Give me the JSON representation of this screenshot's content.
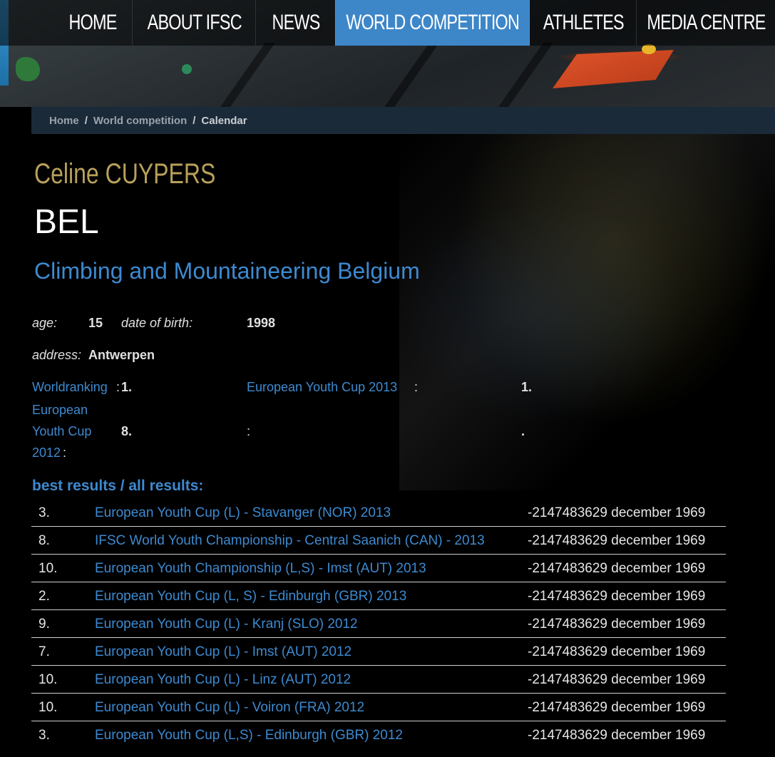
{
  "nav": {
    "items": [
      {
        "label": "HOME",
        "active": false
      },
      {
        "label": "ABOUT IFSC",
        "active": false
      },
      {
        "label": "NEWS",
        "active": false
      },
      {
        "label": "WORLD COMPETITION",
        "active": true
      },
      {
        "label": "ATHLETES",
        "active": false
      },
      {
        "label": "MEDIA CENTRE",
        "active": false
      }
    ]
  },
  "breadcrumb": {
    "home": "Home",
    "sep1": "/",
    "world_competition": "World competition",
    "sep2": "/",
    "current": "Calendar"
  },
  "athlete": {
    "name": "Celine CUYPERS",
    "country": "BEL",
    "federation": "Climbing and Mountaineering Belgium",
    "age_label": "age:",
    "age": "15",
    "dob_label": "date of birth:",
    "dob": "1998",
    "address_label": "address:",
    "address": "Antwerpen"
  },
  "rankings": {
    "worldranking_label": "Worldranking",
    "worldranking_colon": ":",
    "worldranking_value": "1.",
    "euc2013_label": "European Youth Cup 2013",
    "euc2013_colon": ":",
    "euc2013_value": "1.",
    "euc2012_line1": "European",
    "euc2012_line2": "Youth Cup",
    "euc2012_line3": "2012",
    "euc2012_colon": ":",
    "euc2012_value": "8.",
    "empty_colon": ":",
    "empty_value": "."
  },
  "results": {
    "heading": "best results / all results:",
    "rows": [
      {
        "rank": "3.",
        "event": "European Youth Cup (L) - Stavanger (NOR) 2013",
        "date": "-2147483629 december 1969"
      },
      {
        "rank": "8.",
        "event": "IFSC World Youth Championship - Central Saanich (CAN) - 2013",
        "date": "-2147483629 december 1969"
      },
      {
        "rank": "10.",
        "event": "European Youth Championship (L,S) - Imst (AUT) 2013",
        "date": "-2147483629 december 1969"
      },
      {
        "rank": "2.",
        "event": "European Youth Cup (L, S) - Edinburgh (GBR) 2013",
        "date": "-2147483629 december 1969"
      },
      {
        "rank": "9.",
        "event": "European Youth Cup (L) - Kranj (SLO) 2012",
        "date": "-2147483629 december 1969"
      },
      {
        "rank": "7.",
        "event": "European Youth Cup (L) - Imst (AUT) 2012",
        "date": "-2147483629 december 1969"
      },
      {
        "rank": "10.",
        "event": "European Youth Cup (L) - Linz (AUT) 2012",
        "date": "-2147483629 december 1969"
      },
      {
        "rank": "10.",
        "event": "European Youth Cup (L) - Voiron (FRA) 2012",
        "date": "-2147483629 december 1969"
      },
      {
        "rank": "3.",
        "event": "European Youth Cup (L,S) - Edinburgh (GBR) 2012",
        "date": "-2147483629 december 1969"
      }
    ]
  },
  "colors": {
    "accent_blue": "#3d86c8",
    "link_blue": "#3d8ad0",
    "name_gold": "#b8a05a",
    "background": "#000000"
  }
}
